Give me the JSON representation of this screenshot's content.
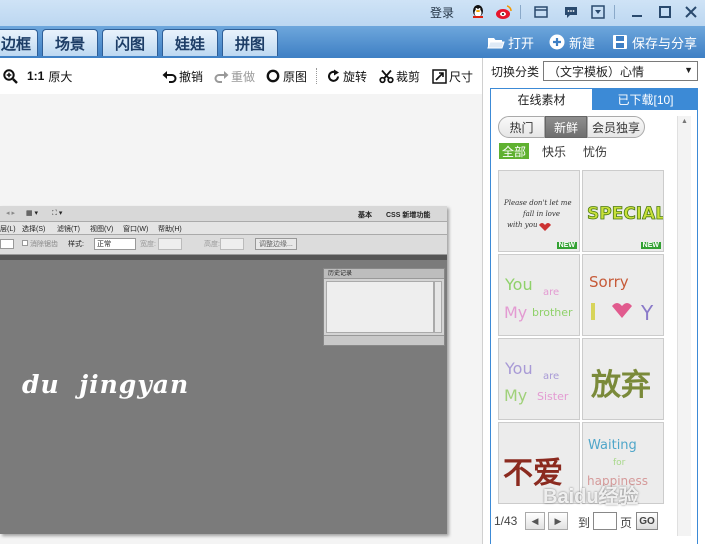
{
  "titlebar": {
    "login_label": "登录"
  },
  "tabs": [
    {
      "label": "边框"
    },
    {
      "label": "场景"
    },
    {
      "label": "闪图"
    },
    {
      "label": "娃娃"
    },
    {
      "label": "拼图"
    }
  ],
  "tab_actions": {
    "open": "打开",
    "new": "新建",
    "save_share": "保存与分享"
  },
  "toolbar": {
    "zoom_ratio": "1:1",
    "original_size": "原大",
    "undo": "撤销",
    "redo": "重做",
    "original_image": "原图",
    "rotate": "旋转",
    "crop": "裁剪",
    "size": "尺寸"
  },
  "photo": {
    "watermark": "du  jingyan",
    "ps_panel_title": "历史记录",
    "ps_top_items": [
      "基本",
      "CSS 新增功能"
    ],
    "ps_menu_items": [
      "层(L)",
      "选择(S)",
      "滤镜(T)",
      "视图(V)",
      "窗口(W)",
      "帮助(H)"
    ],
    "ps_options": {
      "antialias": "消除锯齿",
      "style_label": "样式:",
      "style_value": "正常",
      "width_label": "宽度:",
      "height_label": "高度:",
      "refine": "调整边缘..."
    }
  },
  "panel": {
    "category_label": "切换分类",
    "category_value": "（文字模板）心情",
    "tabs": {
      "online": "在线素材",
      "downloaded": "已下载[10]"
    },
    "segments": [
      "热门",
      "新鲜",
      "会员独享"
    ],
    "filters": [
      "全部",
      "快乐",
      "忧伤"
    ],
    "new_badge": "NEW",
    "thumbnails": [
      {
        "text": "Please don't let me fall in love with you"
      },
      {
        "text": "SPECIAL"
      },
      {
        "text": "You are My brother"
      },
      {
        "text": "Sorry"
      },
      {
        "text": "You are My Sister"
      },
      {
        "text": "放弃"
      },
      {
        "text": "不爱"
      },
      {
        "text": "Waiting for happiness"
      }
    ],
    "pager": {
      "page_info": "1/43",
      "goto_label": "到",
      "page_label": "页",
      "go_label": "GO"
    }
  },
  "watermark": "Baidu经验",
  "colors": {
    "tabbar": "#3e7fc4",
    "panel_accent": "#3c8ad6",
    "filter_active": "#5fb130"
  }
}
